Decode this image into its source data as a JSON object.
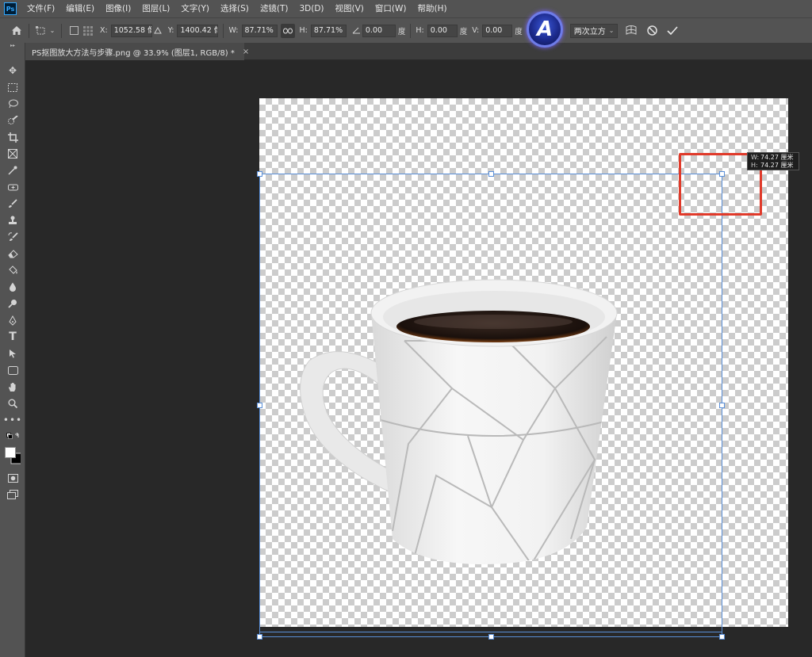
{
  "app": {
    "logo_text": "Ps"
  },
  "menu": [
    "文件(F)",
    "编辑(E)",
    "图像(I)",
    "图层(L)",
    "文字(Y)",
    "选择(S)",
    "滤镜(T)",
    "3D(D)",
    "视图(V)",
    "窗口(W)",
    "帮助(H)"
  ],
  "options": {
    "x_label": "X:",
    "x_value": "1052.58 像",
    "y_label": "Y:",
    "y_value": "1400.42 像",
    "w_label": "W:",
    "w_value": "87.71%",
    "h_label": "H:",
    "h_value": "87.71%",
    "angle_value": "0.00",
    "angle_unit": "度",
    "hskew_label": "H:",
    "hskew_value": "0.00",
    "hskew_unit": "度",
    "vskew_label": "V:",
    "vskew_value": "0.00",
    "vskew_unit": "度",
    "interpolation": "两次立方",
    "badge_letter": "A"
  },
  "document_tab": {
    "title": "PS抠图放大方法与步骤.png @ 33.9% (图层1, RGB/8) *",
    "close": "×"
  },
  "size_tooltip": {
    "w_key": "W:",
    "w_value": "74.27 厘米",
    "h_key": "H:",
    "h_value": "74.27 厘米"
  },
  "colors": {
    "accent_blue": "#5a8fd8",
    "highlight_red": "#e03a2a",
    "ui_gray": "#535353"
  },
  "tools": [
    "move-icon",
    "marquee-icon",
    "lasso-icon",
    "quick-select-icon",
    "crop-icon",
    "frame-icon",
    "eyedropper-icon",
    "healing-icon",
    "brush-icon",
    "stamp-icon",
    "history-brush-icon",
    "eraser-icon",
    "paint-bucket-icon",
    "blur-icon",
    "dodge-icon",
    "pen-icon",
    "type-icon",
    "path-select-icon",
    "shape-icon",
    "hand-icon",
    "zoom-icon",
    "more-tools-icon"
  ]
}
